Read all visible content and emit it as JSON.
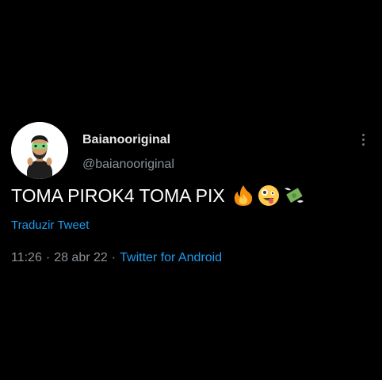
{
  "tweet": {
    "display_name": "Baianooriginal",
    "handle": "@baianooriginal",
    "text": "TOMA PIROK4 TOMA PIX",
    "emojis": [
      "fire-emoji",
      "zany-face-emoji",
      "money-with-wings-emoji"
    ],
    "translate_label": "Traduzir Tweet",
    "time": "11:26",
    "date": "28 abr 22",
    "separator": "·",
    "source": "Twitter for Android"
  },
  "colors": {
    "background": "#000000",
    "text": "#ffffff",
    "secondary_text": "#8b9298",
    "link": "#1d9bf0"
  }
}
